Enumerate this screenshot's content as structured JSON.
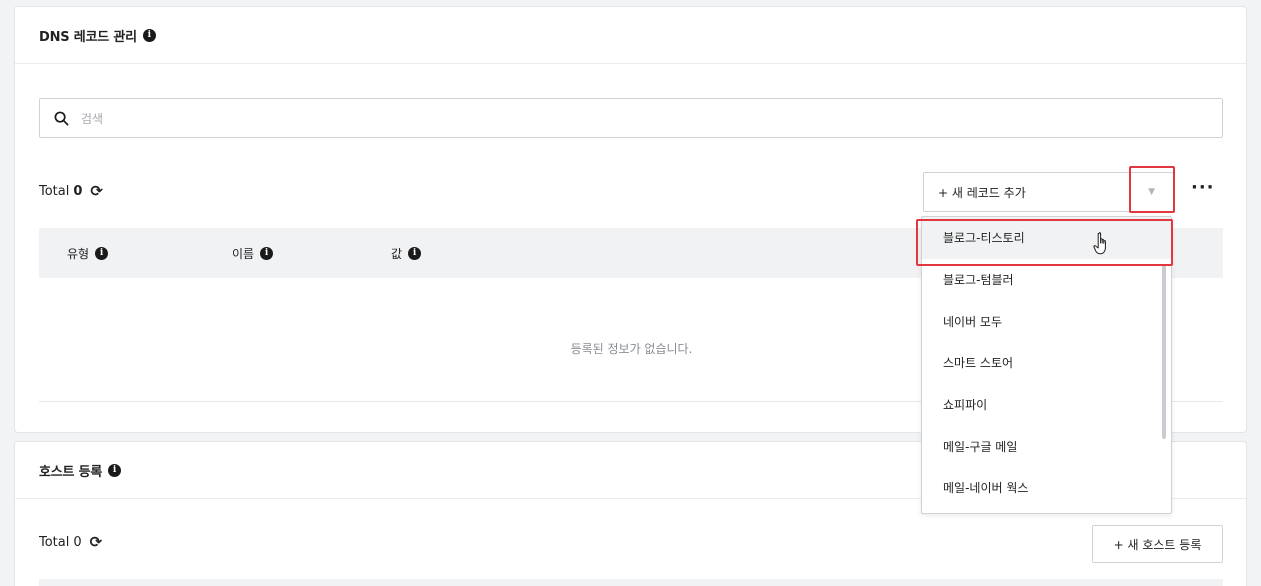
{
  "dns_card": {
    "title": "DNS 레코드 관리",
    "search_placeholder": "검색",
    "total_label": "Total",
    "total_count": "0",
    "add_record_label": "+ 새 레코드 추가",
    "columns": [
      "유형",
      "이름",
      "값"
    ],
    "empty_message": "등록된 정보가 없습니다."
  },
  "record_dropdown": {
    "options": [
      "블로그-티스토리",
      "블로그-텀블러",
      "네이버 모두",
      "스마트 스토어",
      "쇼피파이",
      "메일-구글 메일",
      "메일-네이버 웍스"
    ],
    "highlighted_index": 0
  },
  "host_card": {
    "title": "호스트 등록",
    "total_label": "Total",
    "total_count": "0",
    "add_host_label": "+ 새 호스트 등록"
  },
  "colors": {
    "highlight_border": "#e0383e",
    "page_background": "#f2f3f5",
    "table_header_bg": "#f1f2f4"
  },
  "icons": {
    "info": "info-icon",
    "search": "search-icon",
    "refresh": "refresh-icon",
    "more": "more-horizontal-icon",
    "caret": "caret-down-icon",
    "cursor": "hand-pointer-cursor-icon"
  }
}
